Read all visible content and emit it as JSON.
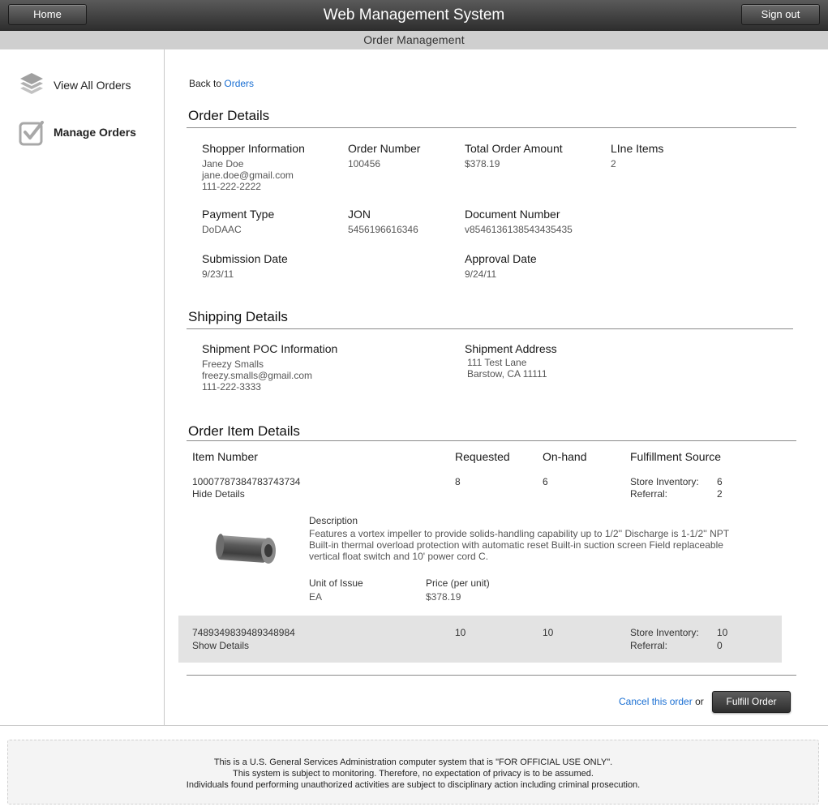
{
  "header": {
    "home_label": "Home",
    "title": "Web Management System",
    "signout_label": "Sign out",
    "subtitle": "Order Management"
  },
  "sidebar": {
    "items": [
      {
        "label": "View All Orders",
        "icon": "layers-icon"
      },
      {
        "label": "Manage Orders",
        "icon": "checkbox-icon",
        "active": true
      }
    ]
  },
  "breadcrumb": {
    "prefix": "Back to",
    "link": "Orders"
  },
  "order_details": {
    "title": "Order Details",
    "shopper": {
      "label": "Shopper Information",
      "name": "Jane Doe",
      "email": "jane.doe@gmail.com",
      "phone": "111-222-2222"
    },
    "order_number": {
      "label": "Order Number",
      "value": "100456"
    },
    "total_amount": {
      "label": "Total Order Amount",
      "value": "$378.19"
    },
    "line_items": {
      "label": "LIne Items",
      "value": "2"
    },
    "payment_type": {
      "label": "Payment Type",
      "value": "DoDAAC"
    },
    "jon": {
      "label": "JON",
      "value": "5456196616346"
    },
    "document_number": {
      "label": "Document Number",
      "value": "v8546136138543435435"
    },
    "submission_date": {
      "label": "Submission Date",
      "value": "9/23/11"
    },
    "approval_date": {
      "label": "Approval Date",
      "value": "9/24/11"
    }
  },
  "shipping": {
    "title": "Shipping Details",
    "poc": {
      "label": "Shipment POC Information",
      "name": "Freezy Smalls",
      "email": "freezy.smalls@gmail.com",
      "phone": "111-222-3333"
    },
    "address": {
      "label": "Shipment Address",
      "line1": "111 Test Lane",
      "line2": "Barstow, CA 11111"
    }
  },
  "items": {
    "title": "Order Item Details",
    "columns": [
      "Item Number",
      "Requested",
      "On-hand",
      "Fulfillment Source"
    ],
    "store_inventory_label": "Store Inventory:",
    "referral_label": "Referral:",
    "rows": [
      {
        "item_number": "10007787384783743734",
        "toggle": "Hide Details",
        "requested": "8",
        "on_hand": "6",
        "store_inventory": "6",
        "referral": "2",
        "details": {
          "description_label": "Description",
          "description": "Features a vortex impeller to provide solids-handling capability up to 1/2'' Discharge is 1-1/2'' NPT Built-in thermal overload protection with automatic reset Built-in suction screen Field replaceable vertical float switch and 10' power cord C.",
          "unit_label": "Unit of Issue",
          "unit": "EA",
          "price_label": "Price (per unit)",
          "price": "$378.19"
        }
      },
      {
        "item_number": "7489349839489348984",
        "toggle": "Show Details",
        "requested": "10",
        "on_hand": "10",
        "store_inventory": "10",
        "referral": "0"
      }
    ]
  },
  "actions": {
    "cancel": "Cancel this order",
    "or": "or",
    "fulfill": "Fulfill Order"
  },
  "footer": {
    "line1": "This is a U.S. General Services Administration computer system that is \"FOR OFFICIAL USE ONLY\".",
    "line2": "This system is subject to monitoring. Therefore, no expectation of privacy is to be assumed.",
    "line3": "Individuals found performing unauthorized activities are subject to disciplinary action including criminal prosecution."
  }
}
